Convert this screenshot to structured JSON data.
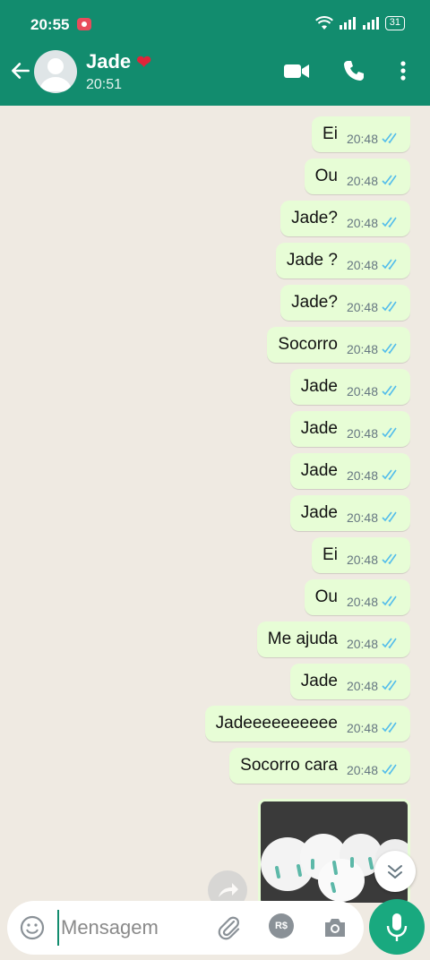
{
  "status_bar": {
    "time": "20:55",
    "battery": "31"
  },
  "header": {
    "contact_name": "Jade",
    "heart": "❤",
    "subtitle": "20:51"
  },
  "messages": [
    {
      "text": "Ei",
      "time": "20:48"
    },
    {
      "text": "Ou",
      "time": "20:48"
    },
    {
      "text": "Jade?",
      "time": "20:48"
    },
    {
      "text": "Jade ?",
      "time": "20:48"
    },
    {
      "text": "Jade?",
      "time": "20:48"
    },
    {
      "text": "Socorro",
      "time": "20:48"
    },
    {
      "text": "Jade",
      "time": "20:48"
    },
    {
      "text": "Jade",
      "time": "20:48"
    },
    {
      "text": "Jade",
      "time": "20:48"
    },
    {
      "text": "Jade",
      "time": "20:48"
    },
    {
      "text": "Ei",
      "time": "20:48"
    },
    {
      "text": "Ou",
      "time": "20:48"
    },
    {
      "text": "Me ajuda",
      "time": "20:48"
    },
    {
      "text": "Jade",
      "time": "20:48"
    },
    {
      "text": "Jadeeeeeeeeee",
      "time": "20:48"
    },
    {
      "text": "Socorro cara",
      "time": "20:48"
    }
  ],
  "composer": {
    "placeholder": "Mensagem",
    "currency_label": "R$"
  },
  "colors": {
    "header": "#128c6e",
    "bubble_out": "#e7fdd6",
    "read_ticks": "#53bdeb",
    "mic": "#19a97f"
  }
}
